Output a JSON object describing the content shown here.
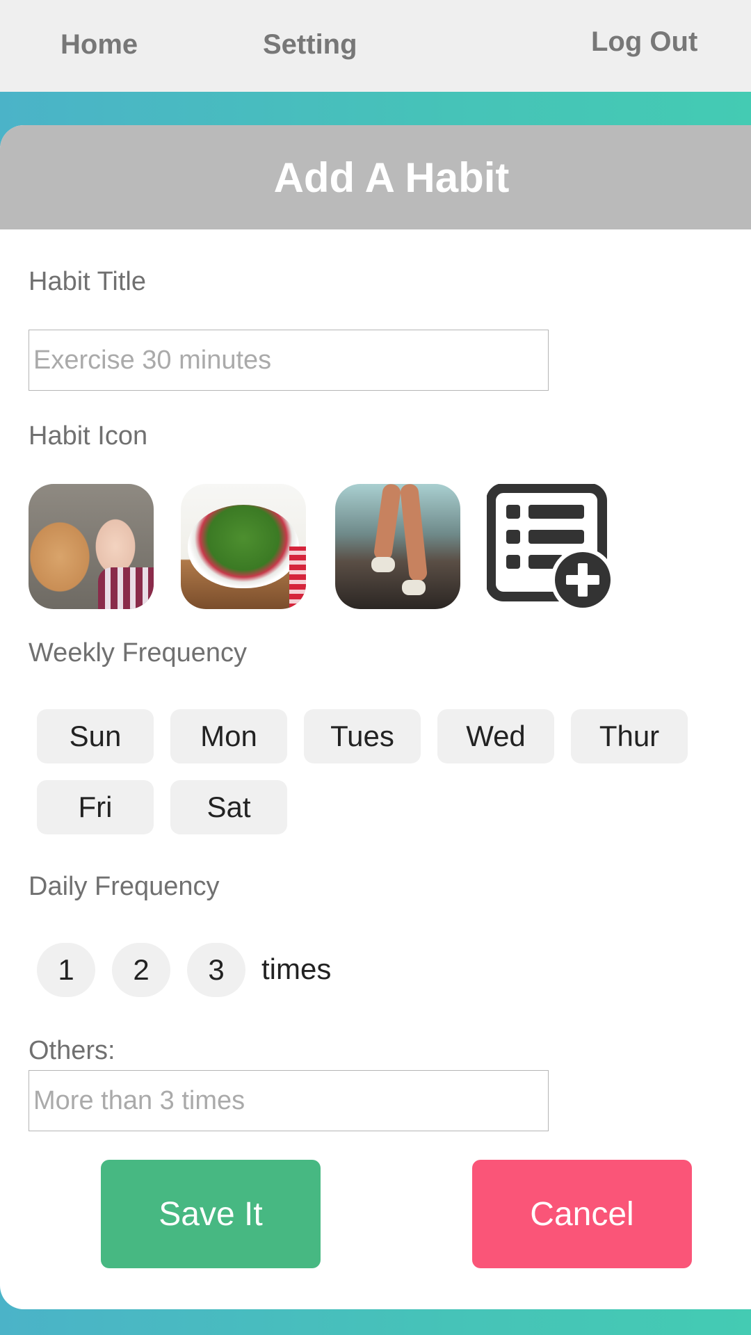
{
  "nav": {
    "home": "Home",
    "setting": "Setting",
    "logout": "Log Out"
  },
  "card": {
    "title": "Add A Habit"
  },
  "habit_title": {
    "label": "Habit Title",
    "placeholder": "Exercise 30 minutes",
    "value": ""
  },
  "habit_icon": {
    "label": "Habit Icon",
    "icons": [
      {
        "name": "cat-and-baby-photo"
      },
      {
        "name": "salad-bowl-photo"
      },
      {
        "name": "runner-legs-photo"
      },
      {
        "name": "add-list-icon"
      }
    ]
  },
  "weekly_frequency": {
    "label": "Weekly Frequency",
    "days": [
      "Sun",
      "Mon",
      "Tues",
      "Wed",
      "Thur",
      "Fri",
      "Sat"
    ]
  },
  "daily_frequency": {
    "label": "Daily Frequency",
    "options": [
      "1",
      "2",
      "3"
    ],
    "unit": "times"
  },
  "others": {
    "label": "Others:",
    "placeholder": "More than 3 times",
    "value": ""
  },
  "actions": {
    "save": "Save It",
    "cancel": "Cancel"
  },
  "colors": {
    "save": "#47b882",
    "cancel": "#fa5578",
    "header": "#bababa",
    "teal": "#46c3b8"
  }
}
